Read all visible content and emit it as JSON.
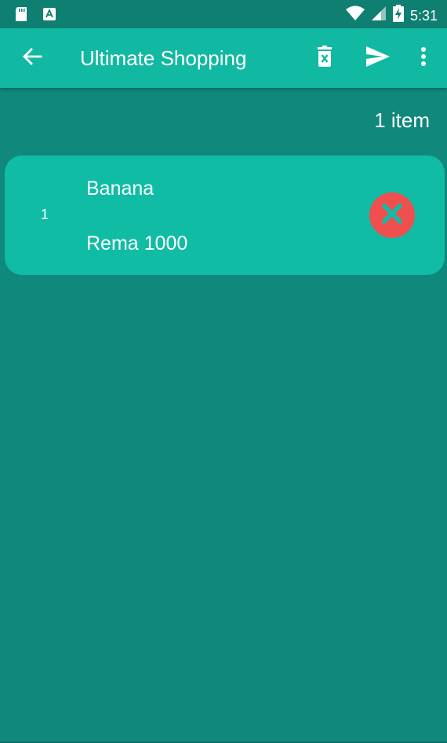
{
  "status_bar": {
    "time": "5:31",
    "icons": [
      "sd-card-icon",
      "app-notification-icon",
      "wifi-icon",
      "cellular-signal-icon",
      "battery-charging-icon"
    ]
  },
  "app_bar": {
    "title": "Ultimate Shopping",
    "back_icon": "arrow-left-icon",
    "actions": [
      "trash-icon",
      "send-icon",
      "more-vert-icon"
    ]
  },
  "list": {
    "item_count": "1 item",
    "items": [
      {
        "quantity": "1",
        "name": "Banana",
        "store": "Rema 1000",
        "remove_icon": "close-circle-icon"
      }
    ]
  },
  "colors": {
    "status_bar": "#0f7f72",
    "app_bar": "#12b9a2",
    "background": "#10887b",
    "card": "#11bca5",
    "remove_button": "#ef4f4f",
    "text": "#ffffff"
  }
}
